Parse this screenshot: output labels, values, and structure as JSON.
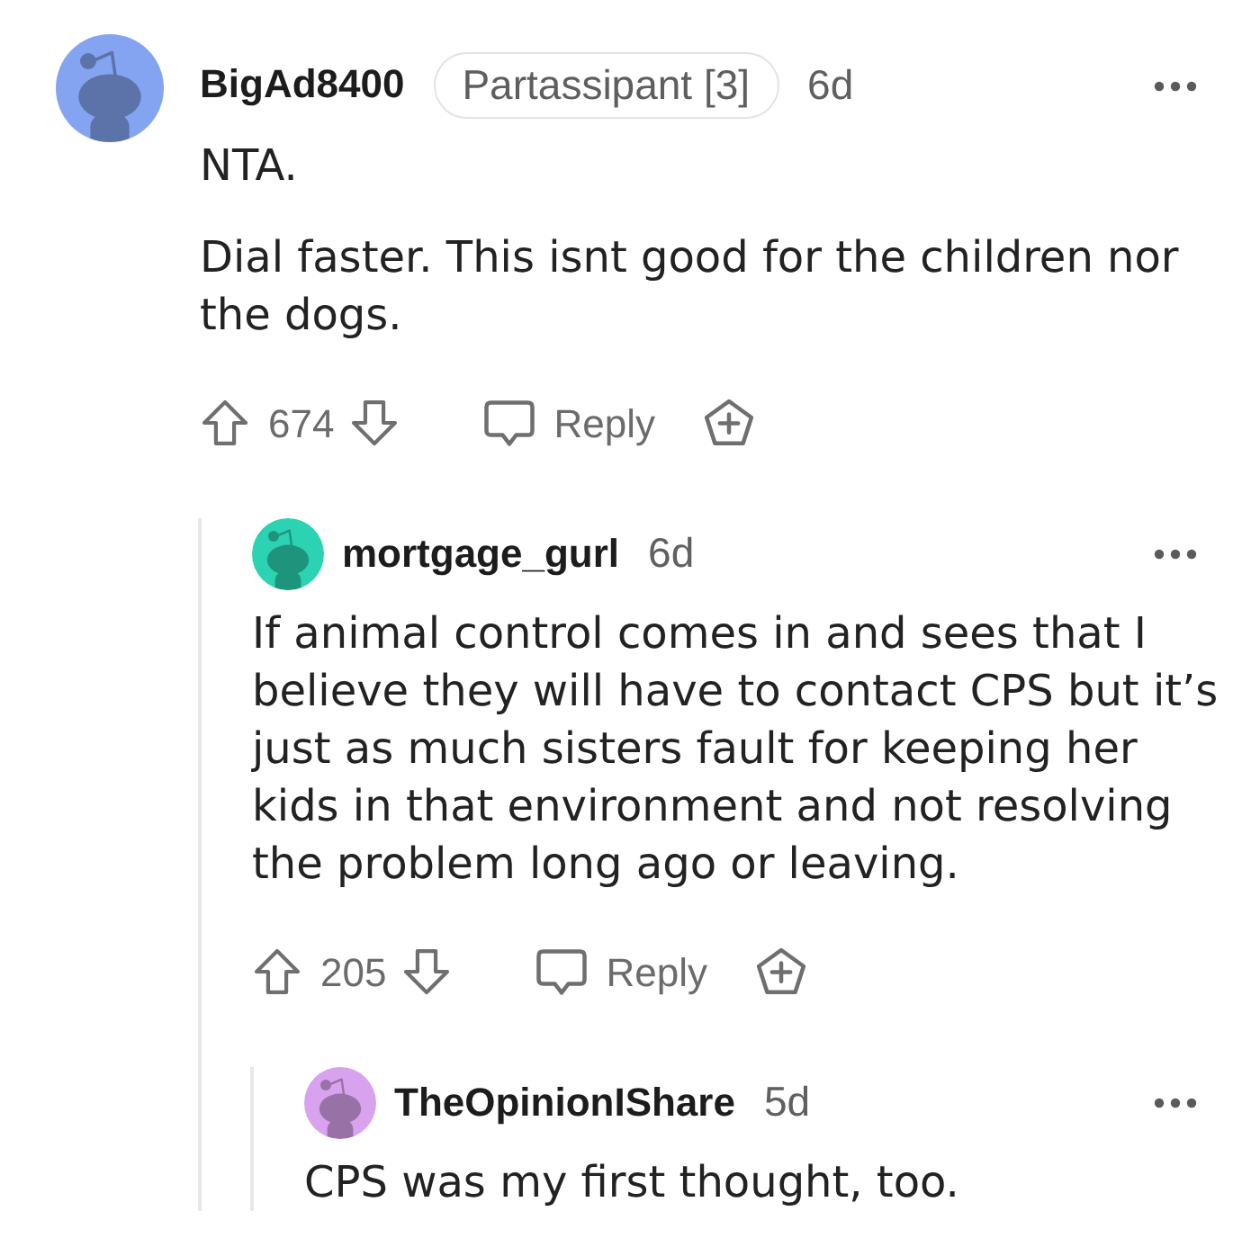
{
  "comments": [
    {
      "author": "BigAd8400",
      "flair": "Partassipant [3]",
      "age": "6d",
      "color": "#84a4f2",
      "paragraphs": [
        "NTA.",
        "Dial faster. This isnt good for the children nor the dogs."
      ],
      "votes": "674",
      "reply": "Reply",
      "children": [
        {
          "author": "mortgage_gurl",
          "age": "6d",
          "color": "#2bd3b2",
          "paragraphs": [
            "If animal control comes in and sees that I believe they will have to contact CPS but it’s just as much sisters fault for keeping her kids in that environment and not resolving the problem long ago or leaving."
          ],
          "votes": "205",
          "reply": "Reply",
          "children": [
            {
              "author": "TheOpinionIShare",
              "age": "5d",
              "color": "#d9a2ef",
              "paragraphs": [
                "CPS was my first thought, too."
              ]
            }
          ]
        }
      ]
    }
  ]
}
